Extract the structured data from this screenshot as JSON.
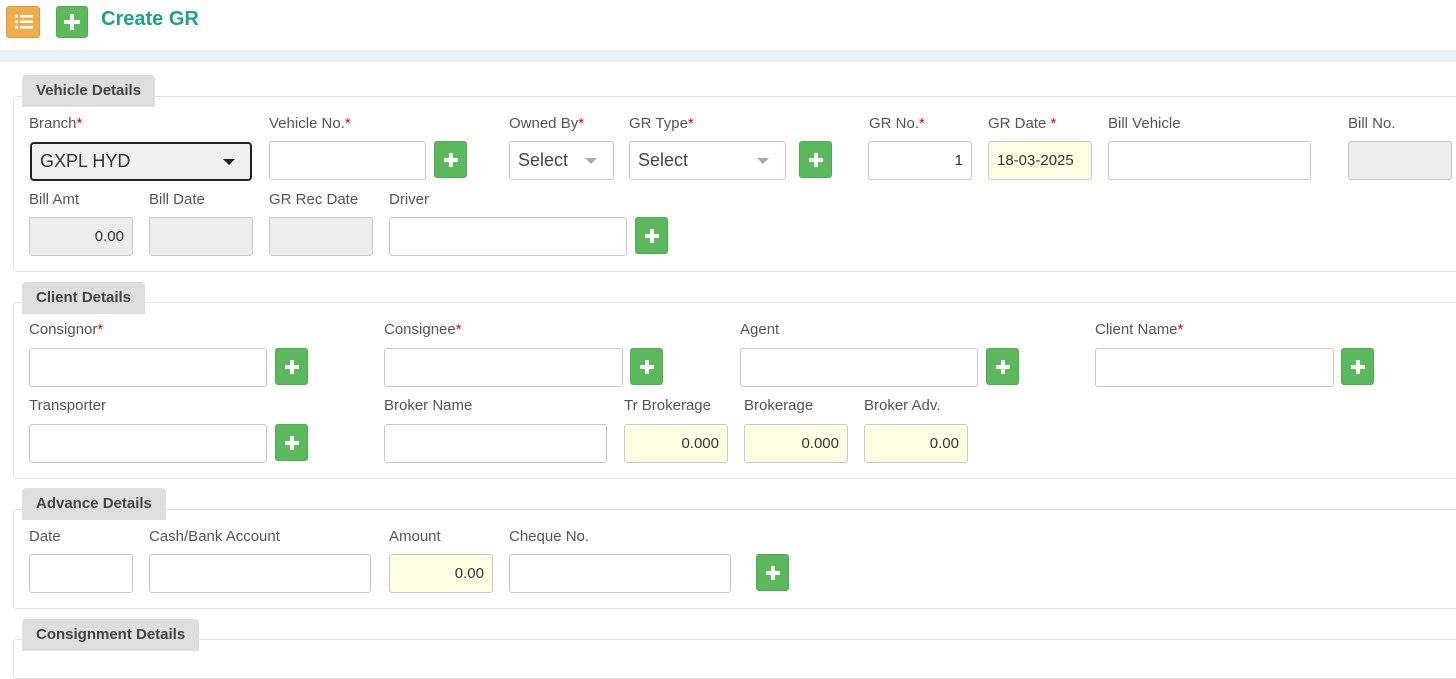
{
  "header": {
    "title": "Create GR",
    "menu_icon": "list-icon",
    "add_icon": "plus-icon"
  },
  "colors": {
    "accent_green": "#5cb85c",
    "title_teal": "#1aa384",
    "menu_orange": "#f0ad4e",
    "required_red": "#e00000"
  },
  "sections": {
    "vehicle": {
      "title": "Vehicle Details",
      "branch": {
        "label": "Branch",
        "value": "GXPL HYD"
      },
      "vehicle_no": {
        "label": "Vehicle No.",
        "value": ""
      },
      "owned_by": {
        "label": "Owned By",
        "value": "Select"
      },
      "gr_type": {
        "label": "GR Type",
        "value": "Select"
      },
      "gr_no": {
        "label": "GR No.",
        "value": "1"
      },
      "gr_date": {
        "label": "GR Date",
        "value": "18-03-2025"
      },
      "bill_vehicle": {
        "label": "Bill Vehicle",
        "value": ""
      },
      "bill_no": {
        "label": "Bill No.",
        "value": ""
      },
      "bill_amt": {
        "label": "Bill Amt",
        "value": "0.00"
      },
      "bill_date": {
        "label": "Bill Date",
        "value": ""
      },
      "gr_rec_date": {
        "label": "GR Rec Date",
        "value": ""
      },
      "driver": {
        "label": "Driver",
        "value": ""
      }
    },
    "client": {
      "title": "Client Details",
      "consignor": {
        "label": "Consignor",
        "value": ""
      },
      "consignee": {
        "label": "Consignee",
        "value": ""
      },
      "agent": {
        "label": "Agent",
        "value": ""
      },
      "client_name": {
        "label": "Client Name",
        "value": ""
      },
      "transporter": {
        "label": "Transporter",
        "value": ""
      },
      "broker_name": {
        "label": "Broker Name",
        "value": ""
      },
      "tr_brokerage": {
        "label": "Tr Brokerage",
        "value": "0.000"
      },
      "brokerage": {
        "label": "Brokerage",
        "value": "0.000"
      },
      "broker_adv": {
        "label": "Broker Adv.",
        "value": "0.00"
      }
    },
    "advance": {
      "title": "Advance Details",
      "date": {
        "label": "Date",
        "value": ""
      },
      "cash_bank": {
        "label": "Cash/Bank Account",
        "value": ""
      },
      "amount": {
        "label": "Amount",
        "value": "0.00"
      },
      "cheque_no": {
        "label": "Cheque No.",
        "value": ""
      }
    },
    "consignment": {
      "title": "Consignment Details"
    }
  },
  "required_mark": "*"
}
